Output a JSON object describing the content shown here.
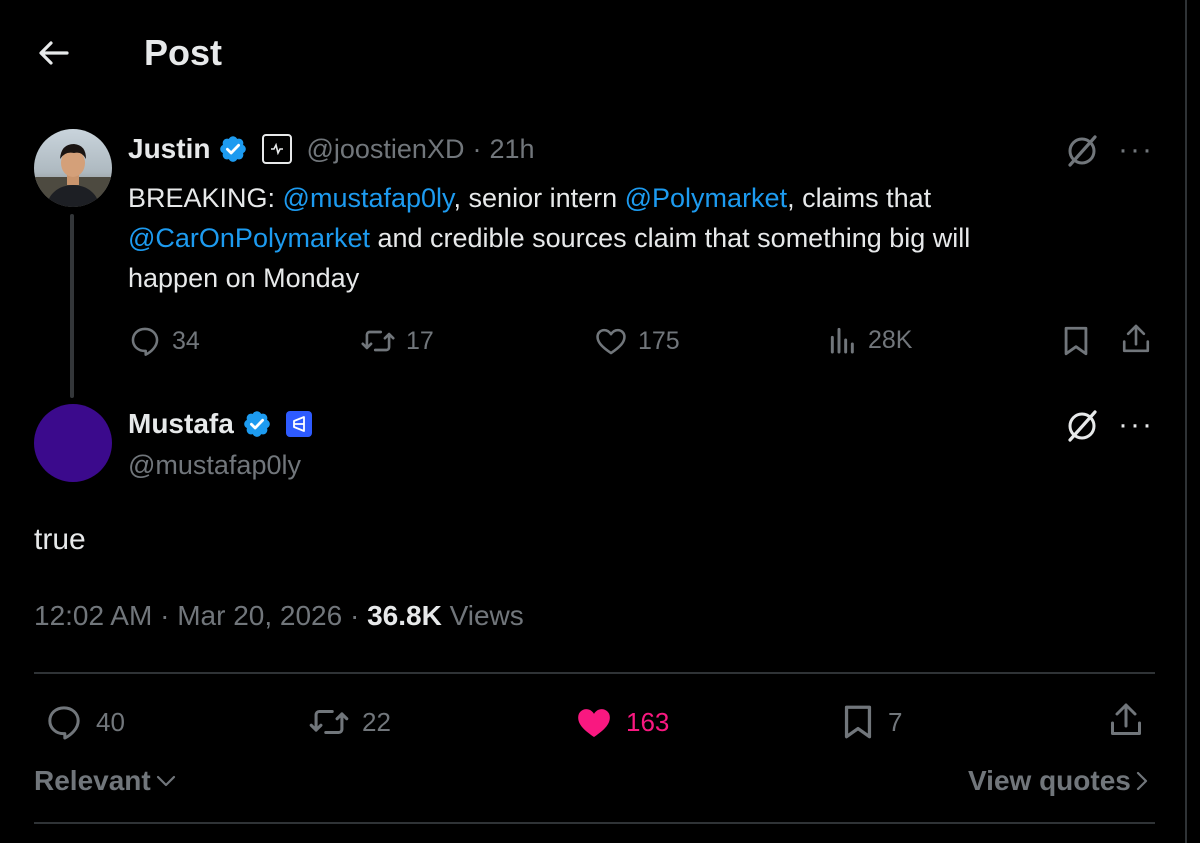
{
  "header": {
    "title": "Post"
  },
  "parent_post": {
    "author": {
      "name": "Justin",
      "handle": "@joostienXD",
      "separator": "·",
      "time": "21h"
    },
    "text": {
      "prefix": "BREAKING: ",
      "mention1": "@mustafap0ly",
      "mid1": ", senior intern ",
      "mention2": "@Polymarket",
      "mid2": ", claims that",
      "mention3": "@CarOnPolymarket",
      "tail": " and credible sources claim that something big will",
      "line3": "happen on Monday"
    },
    "stats": {
      "replies": "34",
      "reposts": "17",
      "likes": "175",
      "views": "28K"
    }
  },
  "main_post": {
    "author": {
      "name": "Mustafa",
      "handle": "@mustafap0ly"
    },
    "text": "true",
    "meta": {
      "time": "12:02 AM",
      "dot1": "·",
      "date": "Mar 20, 2026",
      "dot2": "·",
      "views_count": "36.8K",
      "views_label": "Views"
    },
    "actions": {
      "replies": "40",
      "reposts": "22",
      "likes": "163",
      "bookmarks": "7"
    }
  },
  "replies_bar": {
    "sort_label": "Relevant",
    "view_quotes_label": "View quotes"
  },
  "colors": {
    "background": "#000000",
    "text": "#e7e9ea",
    "muted": "#71767b",
    "link": "#1d9bf0",
    "like": "#f91880",
    "verified": "#1d9bf0",
    "mustafa_avatar": "#3b0a8c"
  },
  "icons": [
    "back-arrow-icon",
    "verified-badge-icon",
    "affiliate-badge-icon",
    "grok-icon",
    "more-icon",
    "reply-icon",
    "repost-icon",
    "like-icon",
    "views-icon",
    "bookmark-icon",
    "share-icon",
    "chevron-down-icon",
    "chevron-right-icon"
  ]
}
